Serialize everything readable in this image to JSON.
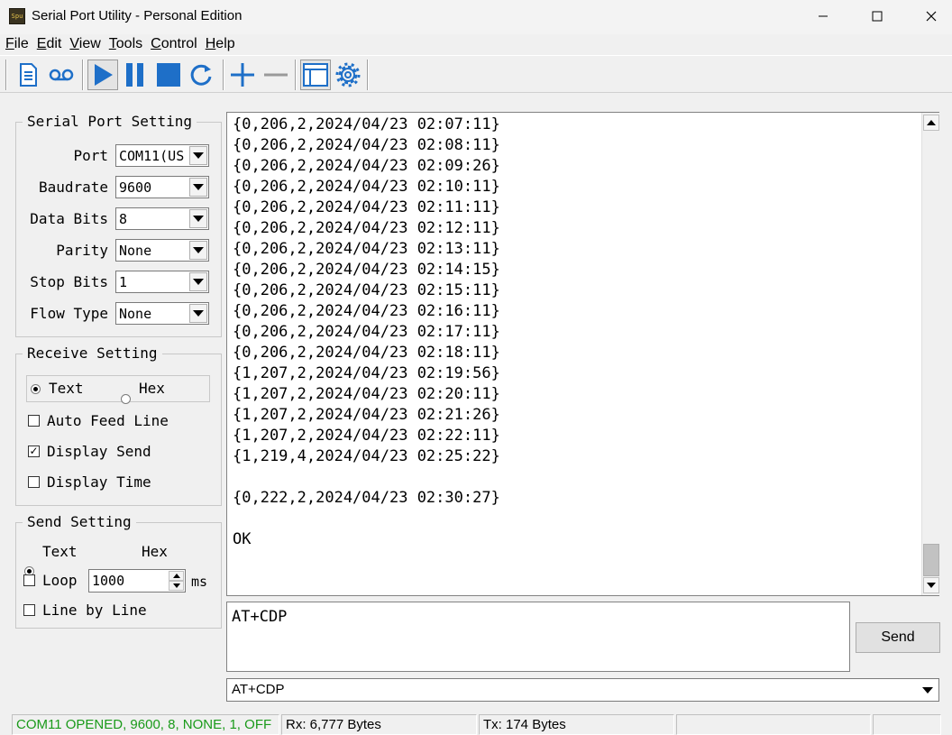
{
  "window": {
    "title": "Serial Port Utility - Personal Edition",
    "icon": "Spu",
    "controls": {
      "minimize": "minimize-icon",
      "maximize": "maximize-icon",
      "close": "close-icon"
    }
  },
  "menu": [
    {
      "label": "File"
    },
    {
      "label": "Edit"
    },
    {
      "label": "View"
    },
    {
      "label": "Tools"
    },
    {
      "label": "Control"
    },
    {
      "label": "Help"
    }
  ],
  "toolbar": {
    "buttons": [
      "new-document",
      "record",
      "start",
      "pause",
      "stop",
      "refresh",
      "add",
      "remove",
      "window",
      "settings"
    ],
    "accent": "#1e6fc8"
  },
  "serial_port_setting": {
    "title": "Serial Port Setting",
    "fields": [
      {
        "label": "Port",
        "value": "COM11(US"
      },
      {
        "label": "Baudrate",
        "value": "9600"
      },
      {
        "label": "Data Bits",
        "value": "8"
      },
      {
        "label": "Parity",
        "value": "None"
      },
      {
        "label": "Stop Bits",
        "value": "1"
      },
      {
        "label": "Flow Type",
        "value": "None"
      }
    ]
  },
  "receive_setting": {
    "title": "Receive Setting",
    "mode_text": "Text",
    "mode_hex": "Hex",
    "mode_selected": "Text",
    "auto_feed_line": {
      "label": "Auto Feed Line",
      "checked": false
    },
    "display_send": {
      "label": "Display Send",
      "checked": true
    },
    "display_time": {
      "label": "Display Time",
      "checked": false
    }
  },
  "send_setting": {
    "title": "Send Setting",
    "mode_text": "Text",
    "mode_hex": "Hex",
    "mode_selected": "Text",
    "loop": {
      "label": "Loop",
      "checked": false,
      "value": "1000",
      "unit": "ms"
    },
    "line_by_line": {
      "label": "Line by Line",
      "checked": false
    }
  },
  "receive_log": [
    "{0,206,2,2024/04/23 02:07:11}",
    "{0,206,2,2024/04/23 02:08:11}",
    "{0,206,2,2024/04/23 02:09:26}",
    "{0,206,2,2024/04/23 02:10:11}",
    "{0,206,2,2024/04/23 02:11:11}",
    "{0,206,2,2024/04/23 02:12:11}",
    "{0,206,2,2024/04/23 02:13:11}",
    "{0,206,2,2024/04/23 02:14:15}",
    "{0,206,2,2024/04/23 02:15:11}",
    "{0,206,2,2024/04/23 02:16:11}",
    "{0,206,2,2024/04/23 02:17:11}",
    "{0,206,2,2024/04/23 02:18:11}",
    "{1,207,2,2024/04/23 02:19:56}",
    "{1,207,2,2024/04/23 02:20:11}",
    "{1,207,2,2024/04/23 02:21:26}",
    "{1,207,2,2024/04/23 02:22:11}",
    "{1,219,4,2024/04/23 02:25:22}",
    "",
    "{0,222,2,2024/04/23 02:30:27}",
    "",
    "OK"
  ],
  "send": {
    "input_value": "AT+CDP",
    "button_label": "Send",
    "history_value": "AT+CDP"
  },
  "status": {
    "connection": "COM11 OPENED, 9600, 8, NONE, 1, OFF",
    "connection_color": "#1a9a1a",
    "rx": "Rx: 6,777 Bytes",
    "tx": "Tx: 174 Bytes"
  }
}
